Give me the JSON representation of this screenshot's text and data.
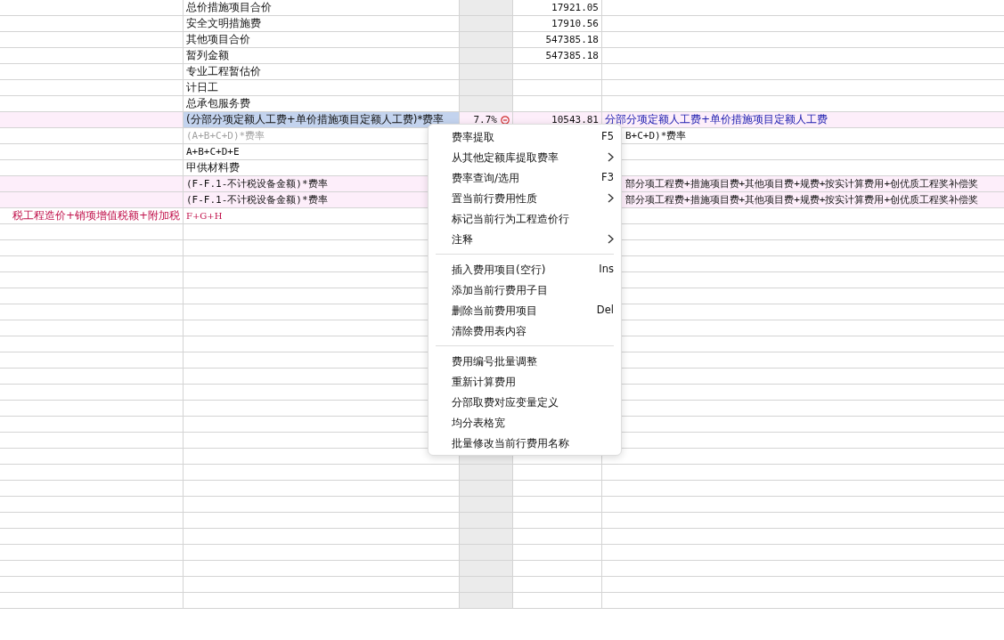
{
  "rows": [
    {
      "highlighted": false,
      "cells": [
        {},
        {
          "text": "总价措施项目合价",
          "kind": "plain"
        },
        {},
        {
          "text": "17921.05",
          "kind": "number"
        },
        {}
      ]
    },
    {
      "highlighted": false,
      "cells": [
        {},
        {
          "text": "安全文明措施费",
          "kind": "plain"
        },
        {},
        {
          "text": "17910.56",
          "kind": "number"
        },
        {}
      ]
    },
    {
      "highlighted": false,
      "cells": [
        {},
        {
          "text": "其他项目合价",
          "kind": "plain"
        },
        {},
        {
          "text": "547385.18",
          "kind": "number"
        },
        {}
      ]
    },
    {
      "highlighted": false,
      "cells": [
        {},
        {
          "text": "暂列金额",
          "kind": "plain"
        },
        {},
        {
          "text": "547385.18",
          "kind": "number"
        },
        {}
      ]
    },
    {
      "highlighted": false,
      "cells": [
        {},
        {
          "text": "专业工程暂估价",
          "kind": "plain"
        },
        {},
        {},
        {}
      ]
    },
    {
      "highlighted": false,
      "cells": [
        {},
        {
          "text": "计日工",
          "kind": "plain"
        },
        {},
        {},
        {}
      ]
    },
    {
      "highlighted": false,
      "cells": [
        {},
        {
          "text": "总承包服务费",
          "kind": "plain"
        },
        {},
        {},
        {}
      ]
    },
    {
      "highlighted": true,
      "cells": [
        {},
        {
          "text": "(分部分项定额人工费+单价措施项目定额人工费)*费率",
          "kind": "plain",
          "selected": true
        },
        {
          "text": "7.7%",
          "kind": "number",
          "marked": true
        },
        {
          "text": "10543.81",
          "kind": "number"
        },
        {
          "text": "分部分项定额人工费+单价措施项目定额人工费",
          "kind": "link"
        }
      ]
    },
    {
      "highlighted": false,
      "cells": [
        {},
        {
          "text": "(A+B+C+D)*费率",
          "kind": "muted"
        },
        {},
        {},
        {
          "text": "B+C+D)*费率",
          "kind": "behind-menu"
        }
      ]
    },
    {
      "highlighted": false,
      "cells": [
        {},
        {
          "text": "A+B+C+D+E",
          "kind": "formula"
        },
        {},
        {},
        {}
      ]
    },
    {
      "highlighted": false,
      "cells": [
        {},
        {
          "text": "甲供材料费",
          "kind": "plain"
        },
        {},
        {},
        {}
      ]
    },
    {
      "highlighted": true,
      "cells": [
        {},
        {
          "text": "(F-F.1-不计税设备金额)*费率",
          "kind": "formula"
        },
        {},
        {},
        {
          "text": "部分项工程费+措施项目费+其他项目费+规费+按实计算费用+创优质工程奖补偿奖",
          "kind": "behind-menu"
        }
      ]
    },
    {
      "highlighted": true,
      "cells": [
        {},
        {
          "text": "(F-F.1-不计税设备金额)*费率",
          "kind": "formula"
        },
        {},
        {},
        {
          "text": "部分项工程费+措施项目费+其他项目费+规费+按实计算费用+创优质工程奖补偿奖",
          "kind": "behind-menu"
        }
      ]
    },
    {
      "highlighted": false,
      "cells": [
        {
          "text": "税工程造价+销项增值税额+附加税",
          "kind": "total"
        },
        {
          "text": "F+G+H",
          "kind": "total-formula"
        },
        {},
        {},
        {}
      ]
    }
  ],
  "context_menu": [
    {
      "kind": "item",
      "label": "费率提取",
      "shortcut": "F5",
      "submenu": false
    },
    {
      "kind": "item",
      "label": "从其他定额库提取费率",
      "submenu": true
    },
    {
      "kind": "item",
      "label": "费率查询/选用",
      "shortcut": "F3",
      "submenu": false
    },
    {
      "kind": "item",
      "label": "置当前行费用性质",
      "submenu": true
    },
    {
      "kind": "item",
      "label": "标记当前行为工程造价行",
      "submenu": false
    },
    {
      "kind": "item",
      "label": "注释",
      "submenu": true
    },
    {
      "kind": "separator"
    },
    {
      "kind": "item",
      "label": "插入费用项目(空行)",
      "shortcut": "Ins",
      "submenu": false
    },
    {
      "kind": "item",
      "label": "添加当前行费用子目",
      "submenu": false
    },
    {
      "kind": "item",
      "label": "删除当前费用项目",
      "shortcut": "Del",
      "submenu": false
    },
    {
      "kind": "item",
      "label": "清除费用表内容",
      "submenu": false
    },
    {
      "kind": "separator"
    },
    {
      "kind": "item",
      "label": "费用编号批量调整",
      "submenu": false
    },
    {
      "kind": "item",
      "label": "重新计算费用",
      "submenu": false
    },
    {
      "kind": "item",
      "label": "分部取费对应变量定义",
      "submenu": false
    },
    {
      "kind": "item",
      "label": "均分表格宽",
      "submenu": false
    },
    {
      "kind": "item",
      "label": "批量修改当前行费用名称",
      "submenu": false
    }
  ]
}
